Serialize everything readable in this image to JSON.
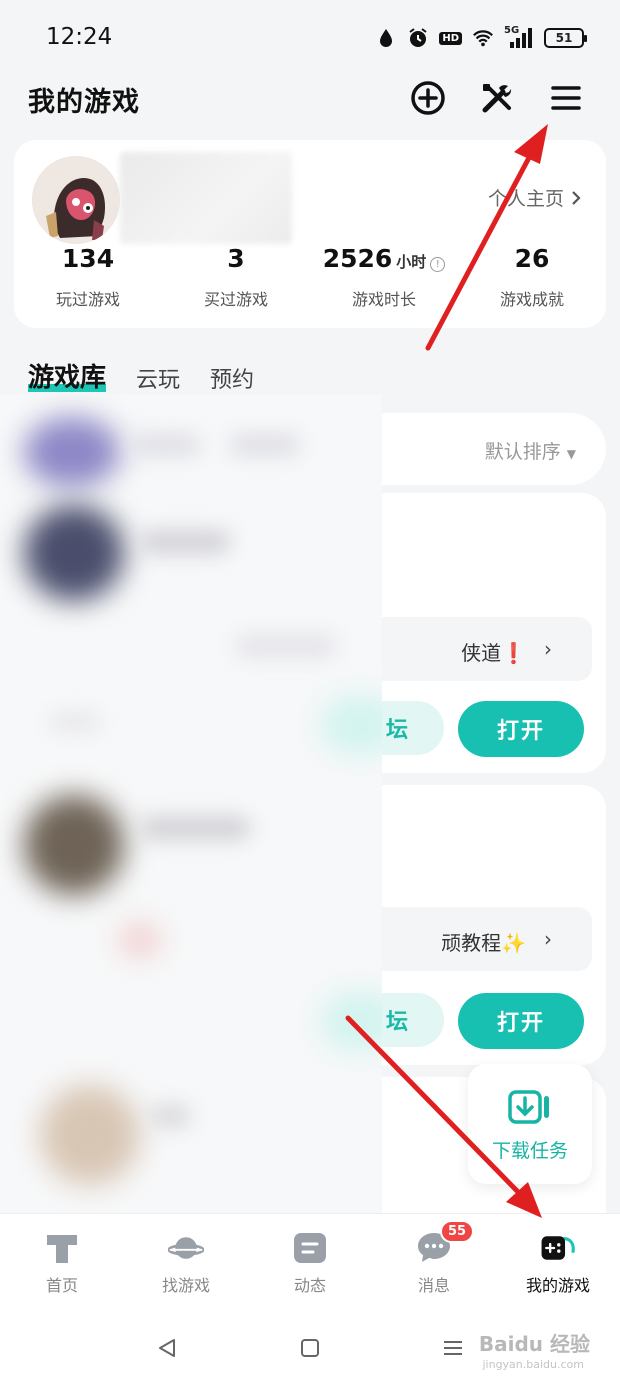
{
  "status_bar": {
    "time": "12:24",
    "hd_label": "HD",
    "network_label": "5G",
    "battery": "51",
    "icons": [
      "water-drop-icon",
      "alarm-icon",
      "hd-icon",
      "wifi-icon",
      "signal-icon",
      "battery-icon"
    ]
  },
  "header": {
    "title": "我的游戏",
    "actions": [
      "add-icon",
      "tools-icon",
      "menu-icon"
    ]
  },
  "profile": {
    "homepage_link": "个人主页",
    "stats": [
      {
        "value": "134",
        "unit": "",
        "label": "玩过游戏"
      },
      {
        "value": "3",
        "unit": "",
        "label": "买过游戏"
      },
      {
        "value": "2526",
        "unit": "小时",
        "label": "游戏时长"
      },
      {
        "value": "26",
        "unit": "",
        "label": "游戏成就"
      }
    ]
  },
  "tabs": [
    {
      "label": "游戏库",
      "active": true
    },
    {
      "label": "云玩",
      "active": false
    },
    {
      "label": "预约",
      "active": false
    }
  ],
  "library": {
    "sort_label": "默认排序",
    "cards": [
      {
        "tip_text": "侠道",
        "tip_emoji": "❗",
        "forum_label": "坛",
        "open_label": "打开"
      },
      {
        "tip_text": "顽教程",
        "tip_emoji": "✨",
        "forum_label": "坛",
        "open_label": "打开"
      }
    ]
  },
  "download_fab": {
    "label": "下载任务"
  },
  "bottom_nav": [
    {
      "label": "首页",
      "icon": "home-icon",
      "active": false
    },
    {
      "label": "找游戏",
      "icon": "planet-icon",
      "active": false
    },
    {
      "label": "动态",
      "icon": "feed-icon",
      "active": false
    },
    {
      "label": "消息",
      "icon": "message-icon",
      "active": false,
      "badge": "55"
    },
    {
      "label": "我的游戏",
      "icon": "gamepad-icon",
      "active": true
    }
  ],
  "watermark": {
    "text": "Baidu 经验",
    "sub": "jingyan.baidu.com"
  },
  "colors": {
    "accent": "#17c0b0",
    "badge": "#f04545",
    "annotation_arrow": "#e02020"
  }
}
